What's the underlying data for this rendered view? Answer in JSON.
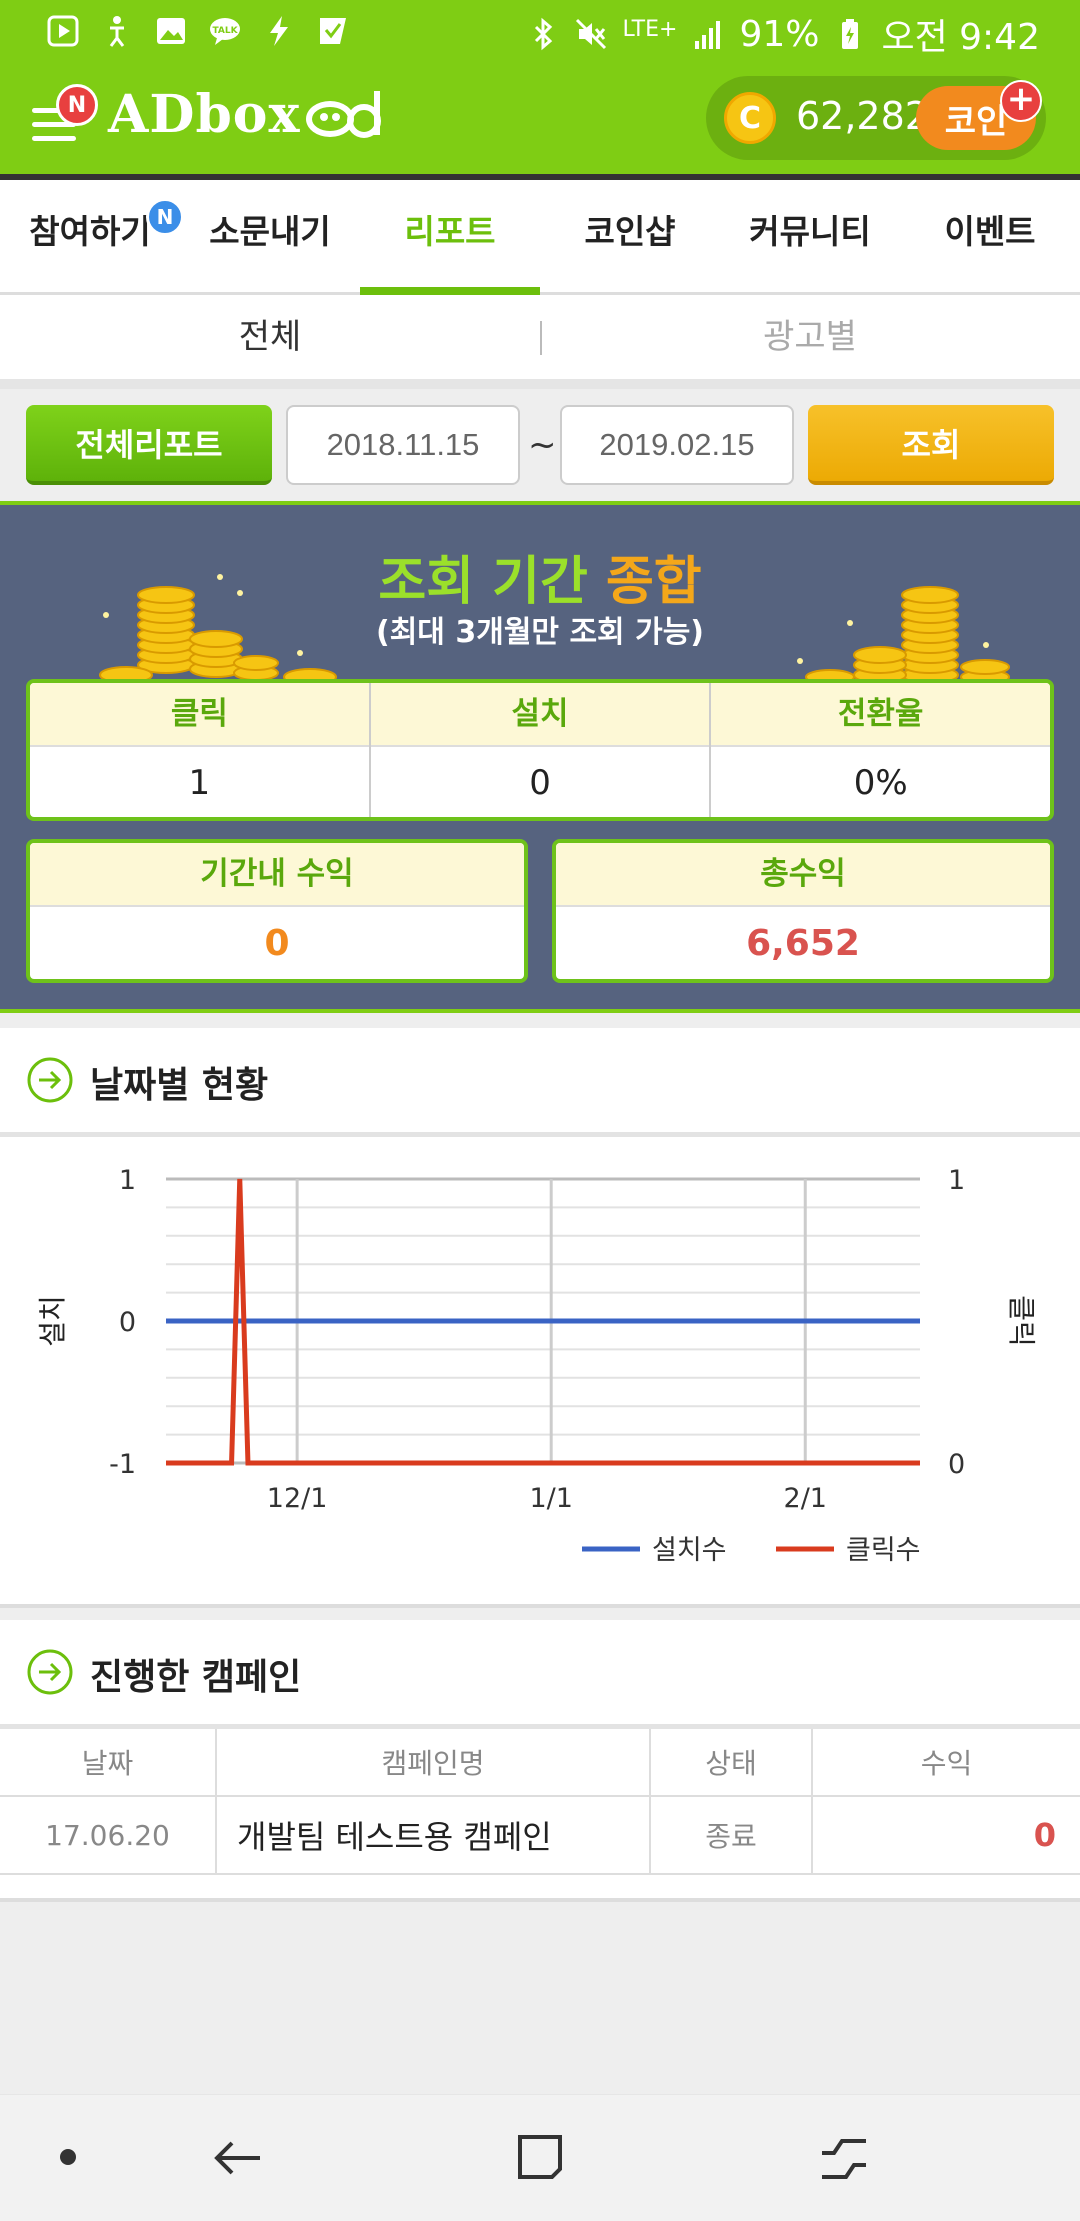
{
  "status_bar": {
    "battery": "91%",
    "time": "오전 9:42",
    "network": "LTE+",
    "left_icons": [
      "play-icon",
      "accessibility-icon",
      "gallery-icon",
      "talk-icon",
      "flash-icon",
      "check-icon"
    ]
  },
  "header": {
    "menu_badge": "N",
    "logo_text": "ADbox",
    "coin_symbol": "C",
    "coin_amount": "62,282",
    "coin_button": "코인",
    "coin_plus": "+"
  },
  "main_tabs": [
    {
      "label": "참여하기",
      "badge": "N"
    },
    {
      "label": "소문내기"
    },
    {
      "label": "리포트",
      "active": true
    },
    {
      "label": "코인샵"
    },
    {
      "label": "커뮤니티"
    },
    {
      "label": "이벤트"
    }
  ],
  "sub_tabs": [
    "전체",
    "광고별"
  ],
  "filter": {
    "report_button": "전체리포트",
    "start_date": "2018.11.15",
    "separator": "~",
    "end_date": "2019.02.15",
    "search_button": "조회"
  },
  "summary": {
    "title_part1": "조회 기간",
    "title_part2": "종합",
    "subtitle": "(최대 3개월만 조회 가능)",
    "stats": [
      {
        "label": "클릭",
        "value": "1"
      },
      {
        "label": "설치",
        "value": "0"
      },
      {
        "label": "전환율",
        "value": "0%"
      }
    ],
    "period_income_label": "기간내 수익",
    "period_income_value": "0",
    "total_income_label": "총수익",
    "total_income_value": "6,652"
  },
  "daily_section": {
    "title": "날짜별 현황"
  },
  "chart_data": {
    "type": "line",
    "x_tick_labels": [
      "12/1",
      "1/1",
      "2/1"
    ],
    "x_ticks": [
      "2018-12-01",
      "2019-01-01",
      "2019-02-01"
    ],
    "xlim": [
      "2018-11-15",
      "2019-02-15"
    ],
    "y_left_label": "설치",
    "y_left_ticks": [
      "1",
      "0",
      "-1"
    ],
    "y_left_lim": [
      -1,
      1
    ],
    "y_right_label": "클릭",
    "y_right_ticks": [
      "1",
      "0"
    ],
    "y_right_lim": [
      0,
      1
    ],
    "series": [
      {
        "name": "설치수",
        "axis": "left",
        "color": "#3a63c4",
        "x": [
          "2018-11-15",
          "2019-02-15"
        ],
        "y": [
          0,
          0
        ]
      },
      {
        "name": "클릭수",
        "axis": "right",
        "color": "#d93b1e",
        "x": [
          "2018-11-15",
          "2018-11-23",
          "2018-11-24",
          "2018-11-25",
          "2019-02-15"
        ],
        "y": [
          0,
          0,
          1,
          0,
          0
        ]
      }
    ],
    "legend_position": "bottom-right",
    "grid": true
  },
  "campaign_section": {
    "title": "진행한 캠페인",
    "columns": [
      "날짜",
      "캠페인명",
      "상태",
      "수익"
    ],
    "rows": [
      {
        "date": "17.06.20",
        "name": "개발팀 테스트용 캠페인",
        "status": "종료",
        "income": "0"
      }
    ]
  },
  "nav_bar": [
    "dot-icon",
    "back-icon",
    "home-icon",
    "recents-icon"
  ],
  "colors": {
    "brand_green": "#7fcd14",
    "summary_bg": "#56637f",
    "accent_orange": "#f28a1e",
    "income_red": "#d9534f",
    "search_yellow": "#f4b512"
  }
}
